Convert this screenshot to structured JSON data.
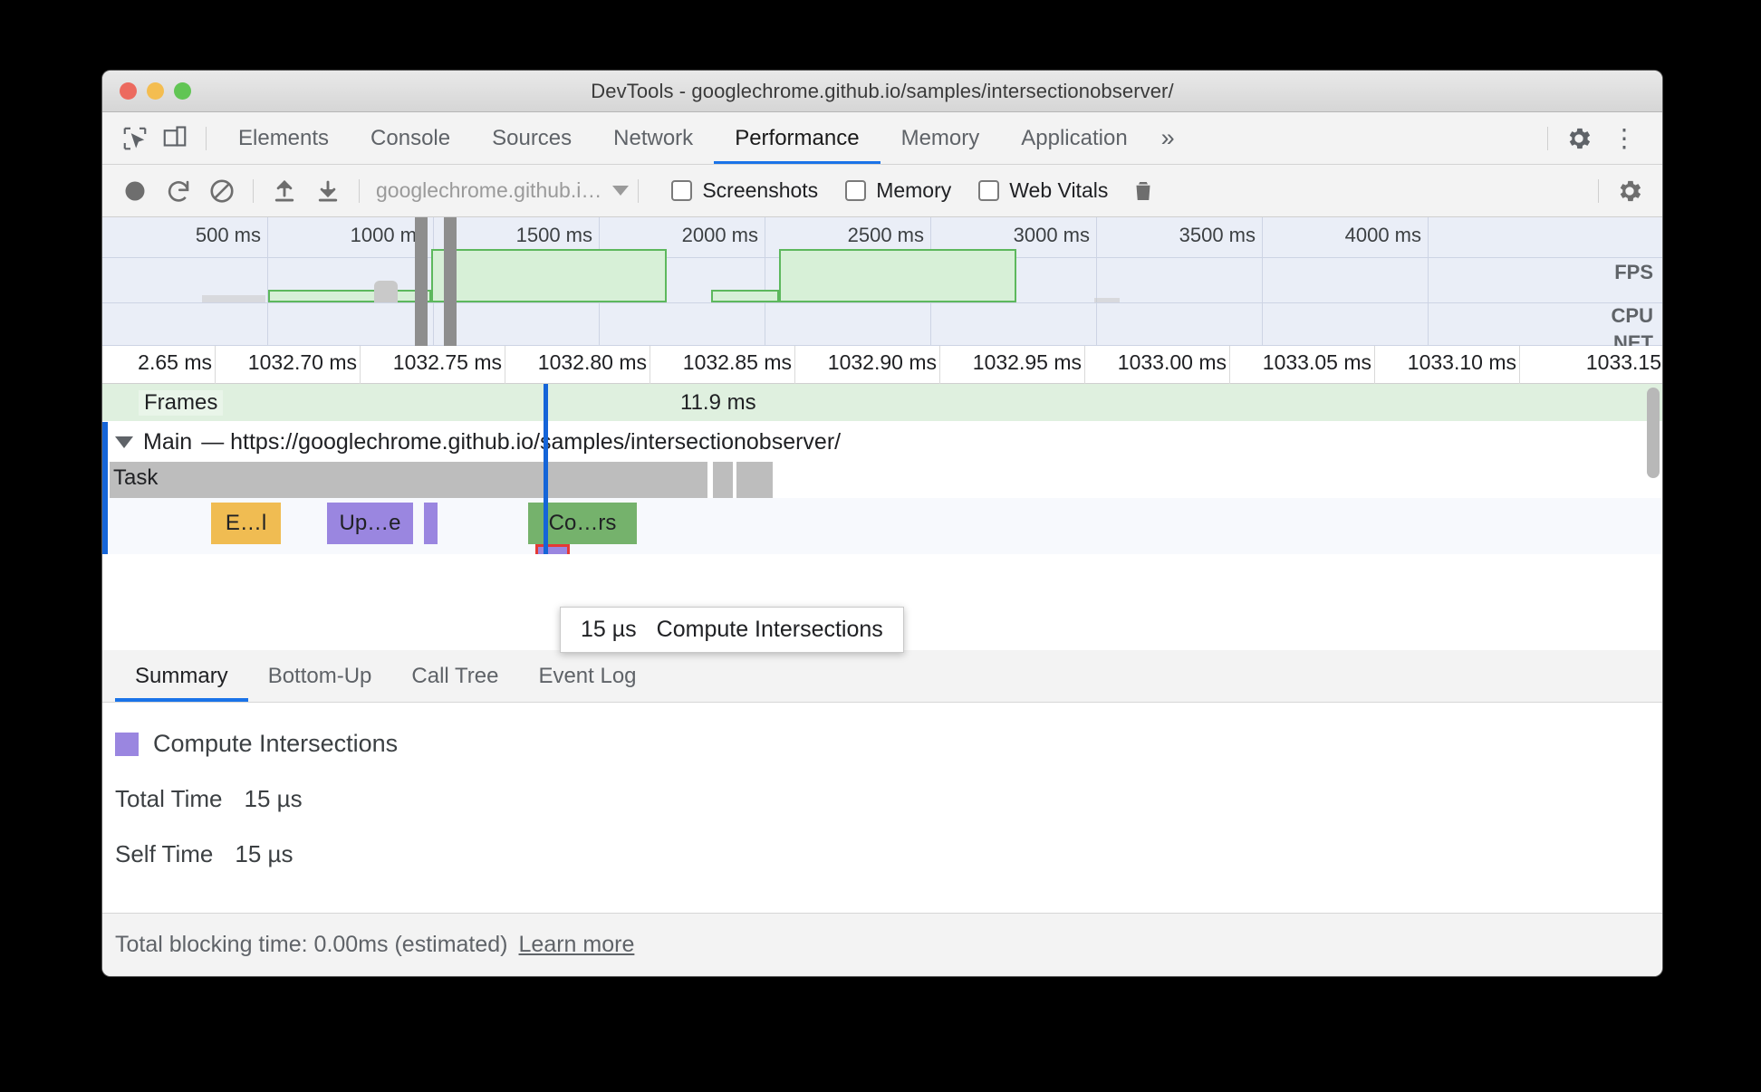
{
  "window": {
    "title": "DevTools - googlechrome.github.io/samples/intersectionobserver/",
    "traffic": {
      "close": "close-button",
      "minimize": "minimize-button",
      "zoom": "zoom-button"
    }
  },
  "tabbar": {
    "inspect_icon": "inspect-element-icon",
    "device_icon": "device-toolbar-icon",
    "tabs": [
      {
        "label": "Elements",
        "active": false
      },
      {
        "label": "Console",
        "active": false
      },
      {
        "label": "Sources",
        "active": false
      },
      {
        "label": "Network",
        "active": false
      },
      {
        "label": "Performance",
        "active": true
      },
      {
        "label": "Memory",
        "active": false
      },
      {
        "label": "Application",
        "active": false
      }
    ],
    "more_label": "»",
    "settings_icon": "gear-icon",
    "kebab_label": "⋮"
  },
  "toolbar": {
    "record_icon": "record-circle-icon",
    "reload_icon": "reload-icon",
    "clear_icon": "clear-prohibited-icon",
    "upload_icon": "upload-arrow-icon",
    "download_icon": "download-arrow-icon",
    "url_value": "googlechrome.github.i…",
    "caret_icon": "chevron-down-icon",
    "checkboxes": [
      {
        "label": "Screenshots",
        "checked": false
      },
      {
        "label": "Memory",
        "checked": false
      },
      {
        "label": "Web Vitals",
        "checked": false
      }
    ],
    "trash_icon": "trash-icon",
    "settings_icon": "gear-icon"
  },
  "overview": {
    "ticks": [
      "500 ms",
      "1000 ms",
      "1500 ms",
      "2000 ms",
      "2500 ms",
      "3000 ms",
      "3500 ms",
      "4000 ms"
    ],
    "rows": [
      "FPS",
      "CPU",
      "NET"
    ]
  },
  "detail_ruler": {
    "ticks": [
      "2.65 ms",
      "1032.70 ms",
      "1032.75 ms",
      "1032.80 ms",
      "1032.85 ms",
      "1032.90 ms",
      "1032.95 ms",
      "1033.00 ms",
      "1033.05 ms",
      "1033.10 ms",
      "1033.15"
    ]
  },
  "tracks": {
    "frames_label": "Frames",
    "frame_duration": "11.9 ms",
    "main_label": "Main",
    "main_url": "— https://googlechrome.github.io/samples/intersectionobserver/",
    "task_label": "Task",
    "events": [
      {
        "label": "E…l",
        "color": "orange"
      },
      {
        "label": "Up…e",
        "color": "purple"
      },
      {
        "label": "",
        "color": "purple"
      },
      {
        "label": "Co…rs",
        "color": "green"
      },
      {
        "label": "",
        "color": "selected"
      }
    ]
  },
  "tooltip": {
    "duration": "15 µs",
    "name": "Compute Intersections"
  },
  "bottom_tabs": [
    {
      "label": "Summary",
      "active": true
    },
    {
      "label": "Bottom-Up",
      "active": false
    },
    {
      "label": "Call Tree",
      "active": false
    },
    {
      "label": "Event Log",
      "active": false
    }
  ],
  "summary": {
    "event_name": "Compute Intersections",
    "swatch_color": "#9a86e0",
    "rows": [
      {
        "label": "Total Time",
        "value": "15 µs"
      },
      {
        "label": "Self Time",
        "value": "15 µs"
      }
    ]
  },
  "statusbar": {
    "text": "Total blocking time: 0.00ms (estimated)",
    "link": "Learn more"
  }
}
